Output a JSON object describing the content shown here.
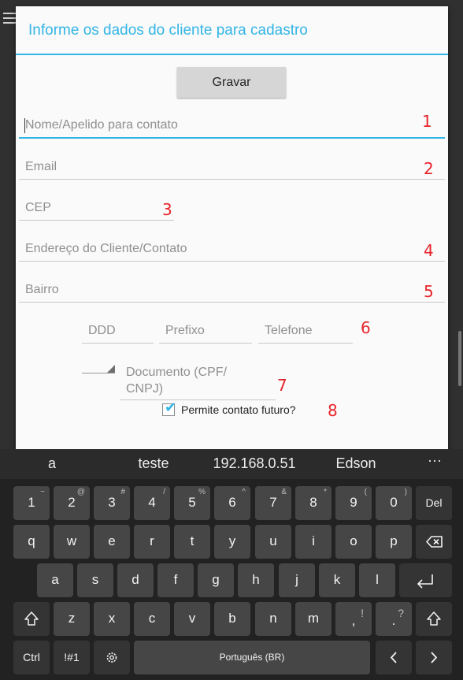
{
  "dialog": {
    "title": "Informe os dados do cliente para cadastro",
    "save_label": "Gravar",
    "fields": {
      "nome": "Nome/Apelido para contato",
      "email": "Email",
      "cep": "CEP",
      "endereco": "Endereço do Cliente/Contato",
      "bairro": "Bairro",
      "ddd": "DDD",
      "prefixo": "Prefixo",
      "telefone": "Telefone",
      "documento_line1": "Documento (CPF/",
      "documento_line2": "CNPJ)"
    },
    "checkbox": {
      "label": "Permite contato futuro?",
      "checked": true
    },
    "annotations": [
      "1",
      "2",
      "3",
      "4",
      "5",
      "6",
      "7",
      "8"
    ]
  },
  "keyboard": {
    "suggestions": [
      "a",
      "teste",
      "192.168.0.51",
      "Edson"
    ],
    "more_label": "···",
    "row1": [
      {
        "k": "1",
        "s": "~"
      },
      {
        "k": "2",
        "s": "@"
      },
      {
        "k": "3",
        "s": "#"
      },
      {
        "k": "4",
        "s": "/"
      },
      {
        "k": "5",
        "s": "%"
      },
      {
        "k": "6",
        "s": "^"
      },
      {
        "k": "7",
        "s": "&"
      },
      {
        "k": "8",
        "s": "*"
      },
      {
        "k": "9",
        "s": "("
      },
      {
        "k": "0",
        "s": ")"
      }
    ],
    "del_label": "Del",
    "row2": [
      "q",
      "w",
      "e",
      "r",
      "t",
      "y",
      "u",
      "i",
      "o",
      "p"
    ],
    "row3": [
      "a",
      "s",
      "d",
      "f",
      "g",
      "h",
      "j",
      "k",
      "l"
    ],
    "row4": [
      "z",
      "x",
      "c",
      "v",
      "b",
      "n",
      "m"
    ],
    "comma": {
      "k": ",",
      "s": "!"
    },
    "period": {
      "k": ".",
      "s": "?"
    },
    "ctrl_label": "Ctrl",
    "sym_label": "!#1",
    "space_label": "Português (BR)",
    "icons": {
      "backspace": "backspace-icon",
      "enter": "enter-icon",
      "shift": "shift-icon",
      "settings": "gear-icon",
      "left": "chevron-left-icon",
      "right": "chevron-right-icon"
    }
  },
  "colors": {
    "accent": "#33b5e5",
    "annotation": "#e8232a"
  }
}
